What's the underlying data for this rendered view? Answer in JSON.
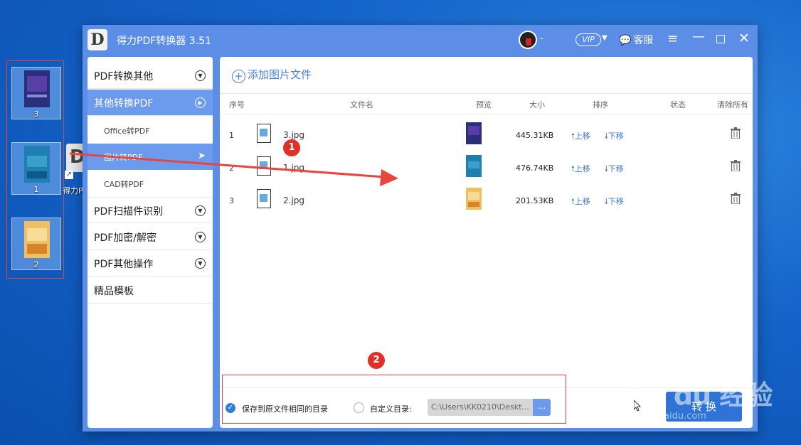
{
  "desktop": {
    "icons": [
      {
        "label": "3"
      },
      {
        "label": "1"
      },
      {
        "label": "2"
      }
    ],
    "shortcut_label": "得力P"
  },
  "window": {
    "logo_letter": "D",
    "title": "得力PDF转换器 3.51",
    "user_name": "-",
    "vip_label": "VIP",
    "service_label": "客服"
  },
  "sidebar": {
    "items": [
      {
        "label": "PDF转换其他"
      },
      {
        "label": "其他转换PDF"
      },
      {
        "label": "Office转PDF"
      },
      {
        "label": "图片转PDF"
      },
      {
        "label": "CAD转PDF"
      },
      {
        "label": "PDF扫描件识别"
      },
      {
        "label": "PDF加密/解密"
      },
      {
        "label": "PDF其他操作"
      },
      {
        "label": "精品模板"
      }
    ]
  },
  "main": {
    "add_label": "添加图片文件",
    "columns": {
      "index": "序号",
      "filename": "文件名",
      "preview": "预览",
      "size": "大小",
      "order": "排序",
      "status": "状态",
      "clear_all": "清除所有"
    },
    "rows": [
      {
        "index": "1",
        "name": "3.jpg",
        "size": "445.31KB",
        "up": "上移",
        "down": "下移",
        "preview_color": "#2a2f7a"
      },
      {
        "index": "2",
        "name": "1.jpg",
        "size": "476.74KB",
        "up": "上移",
        "down": "下移",
        "preview_color": "#1e7fb0"
      },
      {
        "index": "3",
        "name": "2.jpg",
        "size": "201.53KB",
        "up": "上移",
        "down": "下移",
        "preview_color": "#f0c060"
      }
    ],
    "save_same_dir_label": "保存到原文件相同的目录",
    "custom_dir_label": "自定义目录:",
    "path_value": "C:\\Users\\KK0210\\Deskt...",
    "browse_label": "...",
    "convert_label": "转 换"
  },
  "annotations": {
    "badge1": "1",
    "badge2": "2",
    "accent_color": "#e0453f"
  },
  "watermark": {
    "line1": "Bai du 经验",
    "line2": "jingyan.baidu.com"
  }
}
